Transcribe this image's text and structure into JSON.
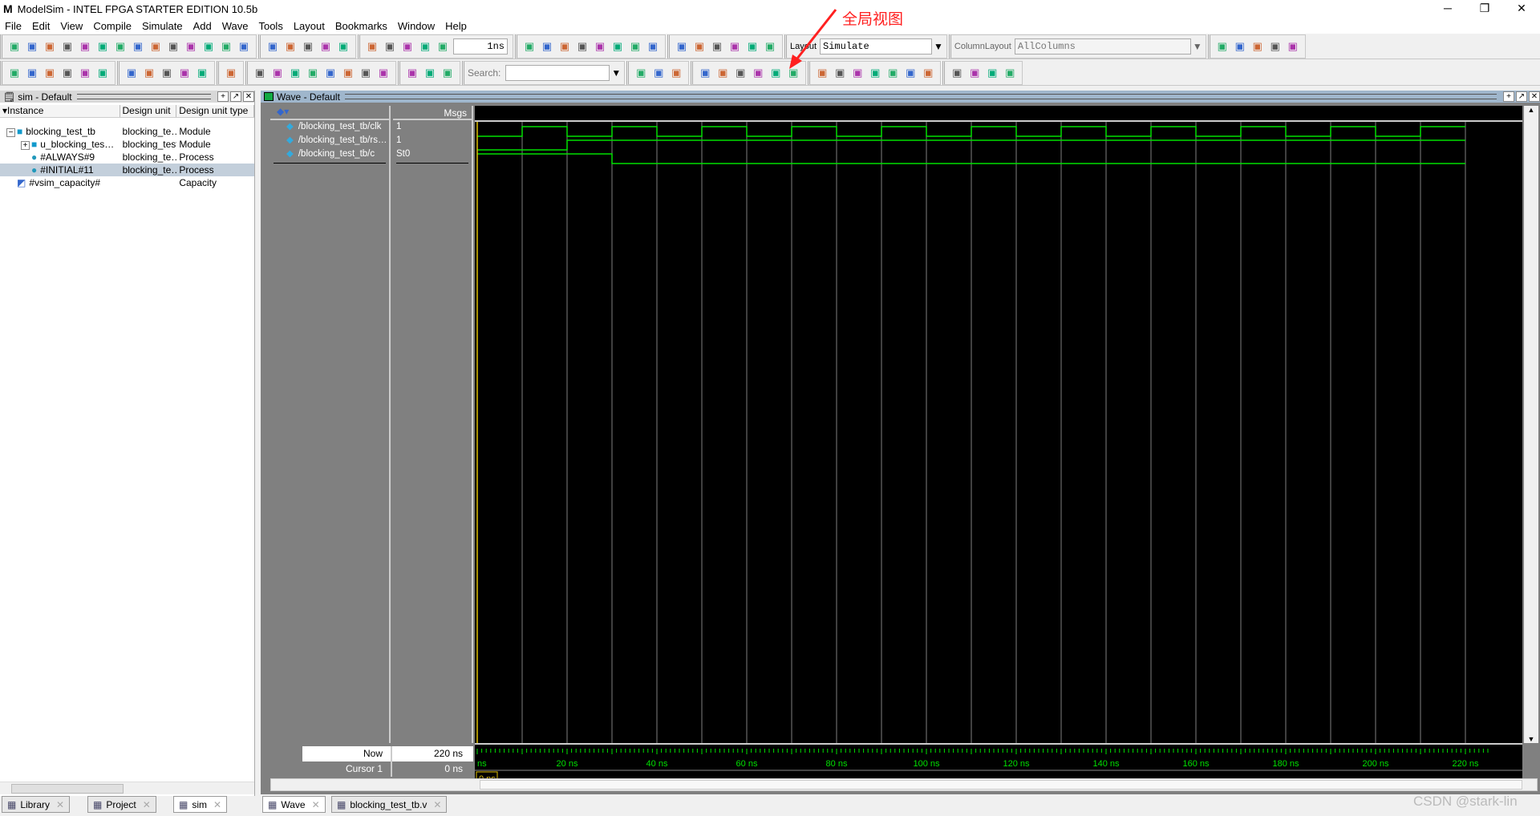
{
  "window": {
    "title": "ModelSim - INTEL FPGA STARTER EDITION 10.5b",
    "logo": "M",
    "controls": [
      "─",
      "❐",
      "✕"
    ]
  },
  "menu": [
    "File",
    "Edit",
    "View",
    "Compile",
    "Simulate",
    "Add",
    "Wave",
    "Tools",
    "Layout",
    "Bookmarks",
    "Window",
    "Help"
  ],
  "toolbar1": {
    "groups": [
      [
        "new-file",
        "open",
        "save",
        "reload",
        "print",
        "cut",
        "copy",
        "paste",
        "undo",
        "redo",
        "compile",
        "find",
        "hierarchy",
        "modelsim"
      ],
      [
        "sim-load",
        "help",
        "break",
        "restart-sim",
        "end-sim"
      ],
      [
        "add-wave",
        "up",
        "back",
        "forward",
        "run-length"
      ]
    ],
    "run_length": "1ns",
    "groups2": [
      [
        "run",
        "continue",
        "run-all",
        "break-run",
        "stop",
        "performance",
        "memory",
        "hand"
      ],
      [
        "step-into",
        "step-over",
        "step-out",
        "step",
        "step-back",
        "step-back-out"
      ]
    ],
    "layout_label": "Layout",
    "layout_value": "Simulate",
    "column_layout_label": "ColumnLayout",
    "column_layout_value": "AllColumns",
    "groups3": [
      [
        "add-layout",
        "remove-layout",
        "edit-layout",
        "save-layout",
        "reset-layout"
      ]
    ]
  },
  "toolbar2": {
    "groups": [
      [
        "wave-1",
        "wave-0",
        "wave-x",
        "wave-z",
        "wave-all",
        "wave-edit"
      ],
      [
        "select-mode",
        "zoom-mode",
        "pan-mode",
        "cursor-mode",
        "split"
      ],
      [
        "traffic-light"
      ],
      [
        "insert-cursor",
        "delete-cursor",
        "prev-edge",
        "next-edge",
        "prev-cursor",
        "next-cursor",
        "first",
        "last"
      ],
      [
        "expand",
        "collapse",
        "insert-divider"
      ]
    ],
    "search_label": "Search:",
    "search_value": "",
    "groups2": [
      [
        "search-forward",
        "search-back",
        "search-options"
      ],
      [
        "zoom-in",
        "zoom-out",
        "zoom-full",
        "zoom-cursor",
        "zoom-range",
        "zoom-last"
      ],
      [
        "wave-lines",
        "wave-fill",
        "wave-solid",
        "wave-pattern",
        "edge-yellow",
        "edge-green",
        "edge-yellow2"
      ],
      [
        "delete-cursor-left",
        "delete-cursor-right",
        "save-wave",
        "clear-wave"
      ]
    ]
  },
  "sim_pane": {
    "title": "sim - Default",
    "columns": [
      "Instance",
      "Design unit",
      "Design unit type"
    ],
    "rows": [
      {
        "instance": "blocking_test_tb",
        "unit": "blocking_te…",
        "type": "Module",
        "icon": "module",
        "expand": "−",
        "indent": 0
      },
      {
        "instance": "u_blocking_tes…",
        "unit": "blocking_test",
        "type": "Module",
        "icon": "module",
        "expand": "+",
        "indent": 1
      },
      {
        "instance": "#ALWAYS#9",
        "unit": "blocking_te…",
        "type": "Process",
        "icon": "process",
        "indent": 1
      },
      {
        "instance": "#INITIAL#11",
        "unit": "blocking_te…",
        "type": "Process",
        "icon": "process",
        "indent": 1,
        "selected": true
      },
      {
        "instance": "#vsim_capacity#",
        "unit": "",
        "type": "Capacity",
        "icon": "capacity",
        "indent": 0
      }
    ]
  },
  "wave_pane": {
    "title": "Wave - Default",
    "msgs_header": "Msgs",
    "signals": [
      {
        "name": "/blocking_test_tb/clk",
        "value": "1"
      },
      {
        "name": "/blocking_test_tb/rs…",
        "value": "1"
      },
      {
        "name": "/blocking_test_tb/c",
        "value": "St0"
      }
    ],
    "now_label": "Now",
    "now_value": "220 ns",
    "cursor_label": "Cursor 1",
    "cursor_value": "0 ns",
    "cursor_time_label": "0 ns",
    "time_ticks": [
      "ns",
      "20 ns",
      "40 ns",
      "60 ns",
      "80 ns",
      "100 ns",
      "120 ns",
      "140 ns",
      "160 ns",
      "180 ns",
      "200 ns",
      "220 ns"
    ],
    "time_range_ns": [
      0,
      225
    ],
    "waves": {
      "clk": {
        "period_ns": 20,
        "first_rise_ns": 10,
        "initial": 0
      },
      "rst": {
        "initial": 0,
        "edges": [
          [
            20,
            1
          ]
        ]
      },
      "c": {
        "initial": 1,
        "edges": [
          [
            30,
            0
          ]
        ]
      }
    },
    "colors": {
      "wave": "#00e000",
      "cursor": "#e0c000",
      "grid": "#808080",
      "bg": "#000000"
    }
  },
  "bottom_tabs_left": [
    {
      "label": "Library",
      "icon": "library"
    },
    {
      "label": "Project",
      "icon": "project"
    },
    {
      "label": "sim",
      "icon": "sim",
      "active": true
    }
  ],
  "bottom_tabs_right": [
    {
      "label": "Wave",
      "icon": "wave",
      "active": true
    },
    {
      "label": "blocking_test_tb.v",
      "icon": "file"
    }
  ],
  "annotation": {
    "text": "全局视图",
    "color": "#ff2020"
  },
  "watermark": "CSDN @stark-lin"
}
